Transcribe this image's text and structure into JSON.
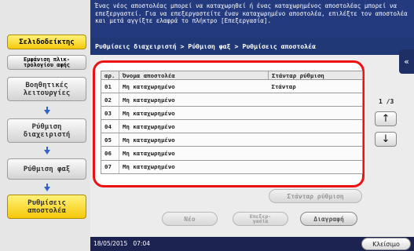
{
  "sidebar": {
    "bookmark_tab": "Σελιδοδείκτης",
    "keypad_tab": "Εμφάνιση πλικ-\nτρολογίου αφής",
    "steps": [
      {
        "label": "Βοηθητικές\nλειτουργίες",
        "active": false
      },
      {
        "label": "Ρύθμιση\nδιαχειριστή",
        "active": false
      },
      {
        "label": "Ρύθμιση φαξ",
        "active": false
      },
      {
        "label": "Ρυθμίσεις\nαποστολέα",
        "active": true
      }
    ]
  },
  "message": "Ένας νέος αποστολέας μπορεί να καταχωρηθεί ή ένας καταχωρημένος αποστολέας μπορεί να επεξεργαστεί. Για να επεξεργαστείτε έναν καταχωρημένο αποστολέα, επιλέξτε τον αποστολέα και μετά αγγίξτε ελαφρά το πλήκτρο [Επεξεργασία].",
  "breadcrumb": "Ρυθμίσεις διαχειριστή > Ρύθμιση φαξ > Ρυθμίσεις αποστολέα",
  "collapse_icon": "«",
  "table": {
    "headers": [
      "αρ.",
      "Όνομα αποστολέα",
      "Στάνταρ ρύθμιση"
    ],
    "rows": [
      {
        "num": "01",
        "name": "Μη καταχωρημένο",
        "default": "Στάνταρ"
      },
      {
        "num": "02",
        "name": "Μη καταχωρημένο",
        "default": ""
      },
      {
        "num": "03",
        "name": "Μη καταχωρημένο",
        "default": ""
      },
      {
        "num": "04",
        "name": "Μη καταχωρημένο",
        "default": ""
      },
      {
        "num": "05",
        "name": "Μη καταχωρημένο",
        "default": ""
      },
      {
        "num": "06",
        "name": "Μη καταχωρημένο",
        "default": ""
      },
      {
        "num": "07",
        "name": "Μη καταχωρημένο",
        "default": ""
      }
    ]
  },
  "pager": {
    "text": "1 /3",
    "up_icon": "↑",
    "down_icon": "↓"
  },
  "buttons": {
    "set_default": "Στάνταρ ρύθμιση",
    "new": "Νέο",
    "edit": "Επεξερ-\nγασία",
    "delete": "Διαγραφή"
  },
  "footer": {
    "date": "18/05/2015",
    "time": "07:04",
    "close": "Κλείσιμο"
  }
}
